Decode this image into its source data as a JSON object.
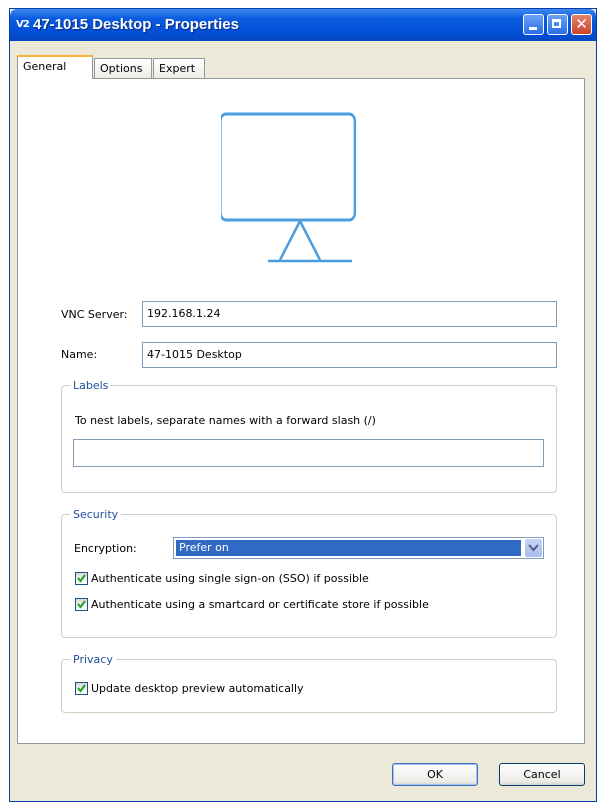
{
  "window": {
    "app_icon_text": "V2",
    "title": "47-1015 Desktop - Properties",
    "controls": {
      "minimize": "minimize-icon",
      "maximize": "maximize-icon",
      "close": "close-icon"
    }
  },
  "tabs": [
    {
      "label": "General",
      "active": true
    },
    {
      "label": "Options",
      "active": false
    },
    {
      "label": "Expert",
      "active": false
    }
  ],
  "general": {
    "preview_icon": "monitor-icon",
    "vnc_server": {
      "label": "VNC Server:",
      "value": "192.168.1.24"
    },
    "name": {
      "label": "Name:",
      "value": "47-1015 Desktop"
    },
    "labels_group": {
      "legend": "Labels",
      "hint": "To nest labels, separate names with a forward slash (/)",
      "value": ""
    },
    "security_group": {
      "legend": "Security",
      "encryption_label": "Encryption:",
      "encryption_value": "Prefer on",
      "sso": {
        "label": "Authenticate using single sign-on (SSO) if possible",
        "checked": true
      },
      "smartcard": {
        "label": "Authenticate using a smartcard or certificate store if possible",
        "checked": true
      }
    },
    "privacy_group": {
      "legend": "Privacy",
      "update_preview": {
        "label": "Update desktop preview automatically",
        "checked": true
      }
    }
  },
  "buttons": {
    "ok": "OK",
    "cancel": "Cancel"
  },
  "colors": {
    "titlebar": "#0350d8",
    "monitor": "#4a9ee0",
    "selection": "#316ac5",
    "group_legend": "#1d4d9b"
  }
}
